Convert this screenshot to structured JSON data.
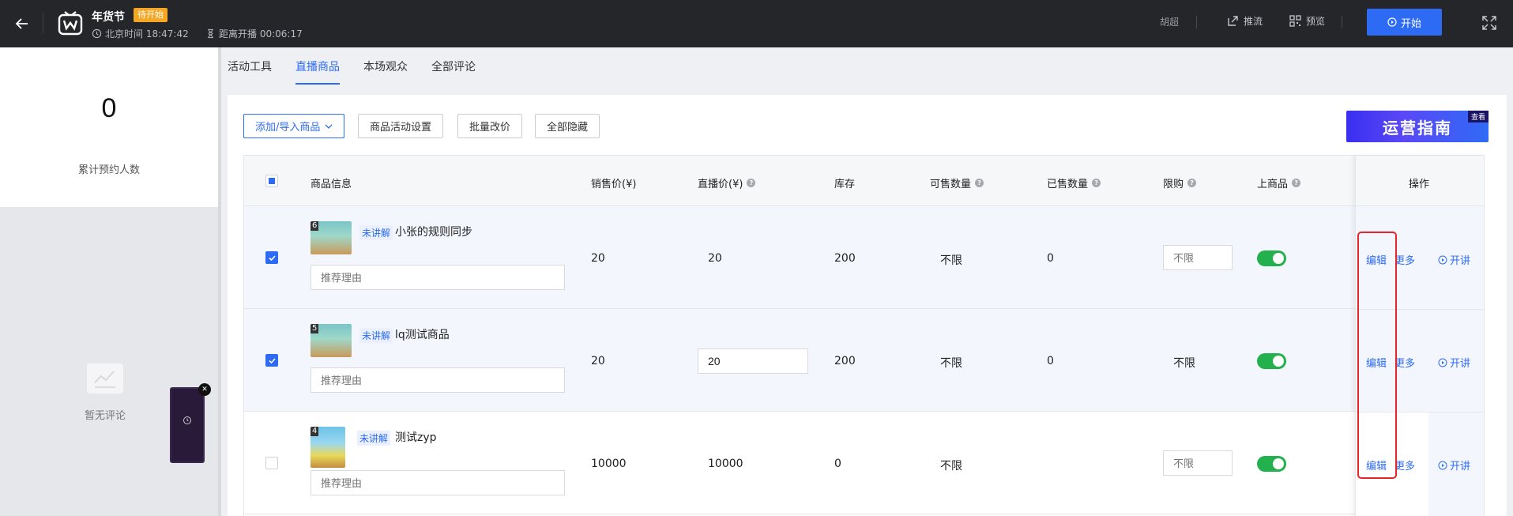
{
  "header": {
    "title": "年货节",
    "status_badge": "待开始",
    "beijing_time": "北京时间 18:47:42",
    "countdown": "距离开播 00:06:17",
    "user": "胡超",
    "push_label": "推流",
    "preview_label": "预览",
    "start_label": "开始"
  },
  "stats": {
    "reservations": "0",
    "reservations_label": "累计预约人数"
  },
  "comments": {
    "empty_label": "暂无评论"
  },
  "tabs": [
    {
      "label": "活动工具",
      "active": false
    },
    {
      "label": "直播商品",
      "active": true
    },
    {
      "label": "本场观众",
      "active": false
    },
    {
      "label": "全部评论",
      "active": false
    }
  ],
  "toolbar": {
    "add_import": "添加/导入商品",
    "activity_settings": "商品活动设置",
    "batch_price": "批量改价",
    "hide_all": "全部隐藏",
    "guide_title": "运营指南",
    "guide_tag": "查看"
  },
  "table": {
    "columns": {
      "info": "商品信息",
      "sale_price": "销售价(¥)",
      "live_price": "直播价(¥)",
      "stock": "库存",
      "available": "可售数量",
      "sold": "已售数量",
      "limit": "限购",
      "listed": "上商品",
      "ops": "操作"
    },
    "reason_placeholder": "推荐理由",
    "limit_placeholder": "不限",
    "rows": [
      {
        "index": "6",
        "status": "未讲解",
        "name": "小张的规则同步",
        "sale_price": "20",
        "live_price": "20",
        "stock": "200",
        "available": "不限",
        "sold": "0",
        "limit": "",
        "checked": true
      },
      {
        "index": "5",
        "status": "未讲解",
        "name": "lq测试商品",
        "sale_price": "20",
        "live_price": "20",
        "stock": "200",
        "available": "不限",
        "sold": "0",
        "limit": "不限",
        "checked": true
      },
      {
        "index": "4",
        "status": "未讲解",
        "name": "测试zyp",
        "sale_price": "10000",
        "live_price": "10000",
        "stock": "0",
        "available": "不限",
        "sold": "",
        "limit": "",
        "checked": false
      }
    ],
    "actions": {
      "edit": "编辑",
      "more": "更多",
      "explain": "开讲"
    }
  },
  "colors": {
    "accent": "#2d6bf5",
    "toggle_on": "#22b14c",
    "badge": "#f5a623",
    "highlight": "#e8232b"
  }
}
